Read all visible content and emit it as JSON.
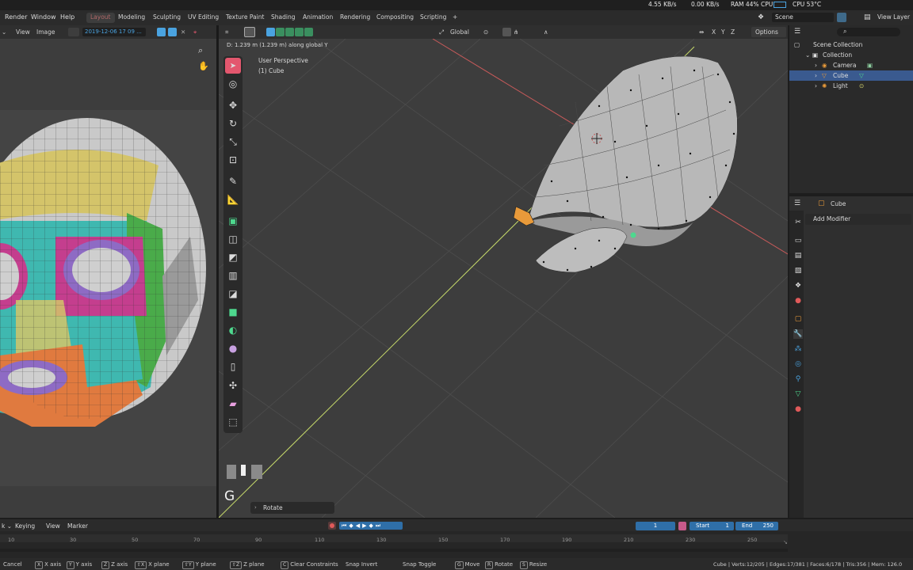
{
  "system": {
    "net_down": "4.55 KB/s",
    "net_up": "0.00 KB/s",
    "ram": "RAM 44%",
    "cpu": "CPU",
    "cpu_temp": "CPU 53°C"
  },
  "menus": [
    "Render",
    "Window",
    "Help"
  ],
  "workspaces": [
    "Layout",
    "Modeling",
    "Sculpting",
    "UV Editing",
    "Texture Paint",
    "Shading",
    "Animation",
    "Rendering",
    "Compositing",
    "Scripting"
  ],
  "add_workspace": "+",
  "scene": {
    "name": "Scene",
    "view_layer": "View Layer"
  },
  "uv_header": {
    "view": "View",
    "image": "Image",
    "image_name": "2019-12-06 17 09 ..."
  },
  "viewport_header": {
    "orientation": "Global",
    "options": "Options",
    "x": "X",
    "y": "Y",
    "z": "Z"
  },
  "viewport": {
    "status": "D: 1.239 m (1.239 m) along global Y",
    "perspective": "User Perspective",
    "object": "(1) Cube",
    "key_hint": "G",
    "operator_panel": "Rotate"
  },
  "outliner": {
    "root": "Scene Collection",
    "collection": "Collection",
    "items": [
      "Camera",
      "Cube",
      "Light"
    ]
  },
  "properties": {
    "object_name": "Cube",
    "add_modifier": "Add Modifier"
  },
  "timeline": {
    "keying": "Keying",
    "view": "View",
    "marker": "Marker",
    "current_frame": "1",
    "start_label": "Start",
    "start": "1",
    "end_label": "End",
    "end": "250",
    "ticks": [
      "10",
      "30",
      "50",
      "70",
      "90",
      "110",
      "130",
      "150",
      "170",
      "190",
      "210",
      "230",
      "250"
    ]
  },
  "statusbar": {
    "items": [
      {
        "key": "",
        "label": "Cancel"
      },
      {
        "key": "X",
        "label": "X axis"
      },
      {
        "key": "Y",
        "label": "Y axis"
      },
      {
        "key": "Z",
        "label": "Z axis"
      },
      {
        "key": "⇧X",
        "label": "X plane"
      },
      {
        "key": "⇧Y",
        "label": "Y plane"
      },
      {
        "key": "⇧Z",
        "label": "Z plane"
      },
      {
        "key": "C",
        "label": "Clear Constraints"
      },
      {
        "key": "",
        "label": "Snap Invert"
      },
      {
        "key": "",
        "label": "Snap Toggle"
      },
      {
        "key": "G",
        "label": "Move"
      },
      {
        "key": "R",
        "label": "Rotate"
      },
      {
        "key": "S",
        "label": "Resize"
      }
    ],
    "stats": "Cube | Verts:12/205 | Edges:17/381 | Faces:6/178 | Tris:356 | Mem: 126.0"
  },
  "colors": {
    "accent": "#e3576e",
    "selection": "#3a5a8f",
    "frame_field": "#2f6fa8",
    "y_axis": "#c6d96a",
    "x_axis": "#c75a5a"
  }
}
